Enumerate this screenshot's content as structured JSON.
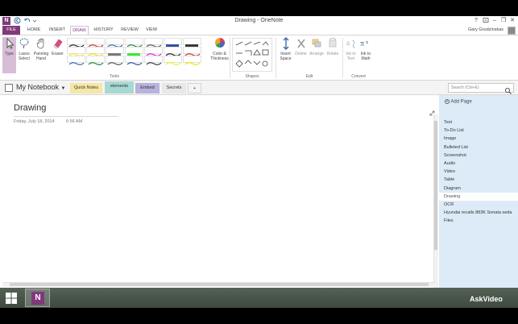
{
  "window": {
    "title": "Drawing - OneNote",
    "app_icon_letter": "N",
    "help": "?",
    "minimize": "–",
    "restore": "❐",
    "close": "✕"
  },
  "ribbon_tabs": [
    "FILE",
    "HOME",
    "INSERT",
    "DRAW",
    "HISTORY",
    "REVIEW",
    "VIEW"
  ],
  "user": {
    "name": "Gary Grudzinskas"
  },
  "ribbon": {
    "tools": [
      {
        "label_line1": "Type",
        "label_line2": ""
      },
      {
        "label_line1": "Lasso",
        "label_line2": "Select"
      },
      {
        "label_line1": "Panning",
        "label_line2": "Hand"
      },
      {
        "label_line1": "Eraser",
        "label_line2": ""
      }
    ],
    "color_thickness": {
      "line1": "Color &",
      "line2": "Thickness"
    },
    "insert_space": {
      "line1": "Insert",
      "line2": "Space"
    },
    "delete": "Delete",
    "arrange": "Arrange",
    "rotate": "Rotate",
    "ink_to_text": {
      "line1": "Ink to",
      "line2": "Text"
    },
    "ink_to_math": {
      "line1": "Ink to",
      "line2": "Math"
    },
    "groups": {
      "tools": "Tools",
      "shapes": "Shapes",
      "edit": "Edit",
      "convert": "Convert"
    },
    "pen_colors": [
      "#222222",
      "#c0392b",
      "#2f6fb0",
      "#1e8a3a",
      "#555555",
      "#3050a0",
      "#3a3a3a",
      "#f0f020",
      "#e8e800",
      "#7a7a7a",
      "#33ee33",
      "#e020e0"
    ]
  },
  "notebook": {
    "name": "My Notebook",
    "sections": [
      {
        "label": "Quick Notes",
        "color": "#f5e7a4"
      },
      {
        "label": "elements",
        "color": "#a8d8d2"
      },
      {
        "label": "Embed",
        "color": "#b6b3de"
      },
      {
        "label": "Secrets",
        "color": "#e8e8e8"
      },
      {
        "label": "+",
        "color": "#ffffff"
      }
    ],
    "search_placeholder": "Search (Ctrl+E)"
  },
  "page": {
    "title": "Drawing",
    "date": "Friday, July 18, 2014",
    "time": "6:56 AM"
  },
  "pages_pane": {
    "add_page": "Add Page",
    "items": [
      "Text",
      "To-Do List",
      "Image",
      "Bulleted List",
      "Screenshot",
      "Audio",
      "Video",
      "Table",
      "Diagram",
      "Drawing",
      "OCR",
      "Hyundai recalls 883K Sonata seda",
      "Files"
    ],
    "active_index": 9
  },
  "watermark": "AskVideo"
}
